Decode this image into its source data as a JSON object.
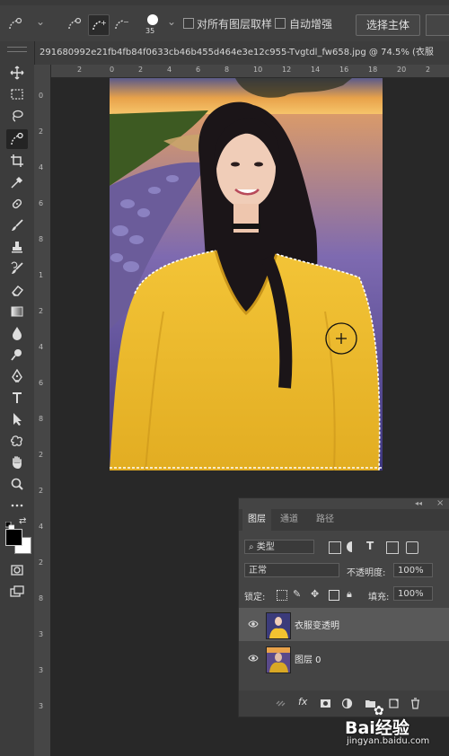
{
  "options_bar": {
    "brush_size": "35",
    "sample_all_layers_label": "对所有图层取样",
    "auto_enhance_label": "自动增强",
    "select_subject_label": "选择主体"
  },
  "document_tab": {
    "title": "291680992e21fb4fb84f0633cb46b455d464e3e12c955-Tvgtdl_fw658.jpg @ 74.5% (衣服"
  },
  "ruler": {
    "top_numbers": [
      "2",
      "0",
      "2",
      "4",
      "6",
      "8",
      "10",
      "12",
      "14",
      "16",
      "18",
      "20",
      "2"
    ],
    "left_numbers": [
      "0",
      "2",
      "4",
      "6",
      "8",
      "1",
      "2",
      "4",
      "6",
      "8",
      "2",
      "2",
      "4",
      "2",
      "8",
      "3",
      "3",
      "3"
    ]
  },
  "layers_panel": {
    "tabs": [
      "图层",
      "通道",
      "路径"
    ],
    "filter_label": "类型",
    "blend_mode": "正常",
    "opacity_label": "不透明度:",
    "opacity_value": "100%",
    "lock_label": "锁定:",
    "fill_label": "填充:",
    "fill_value": "100%",
    "layers": [
      {
        "name": "衣服变透明",
        "selected": true
      },
      {
        "name": "图层 0",
        "selected": false
      }
    ]
  },
  "watermark": {
    "brand": "Bai经验",
    "url": "jingyan.baidu.com"
  },
  "colors": {
    "accent_yellow": "#f2c230",
    "panel_bg": "#444444",
    "canvas_bg": "#282828"
  }
}
